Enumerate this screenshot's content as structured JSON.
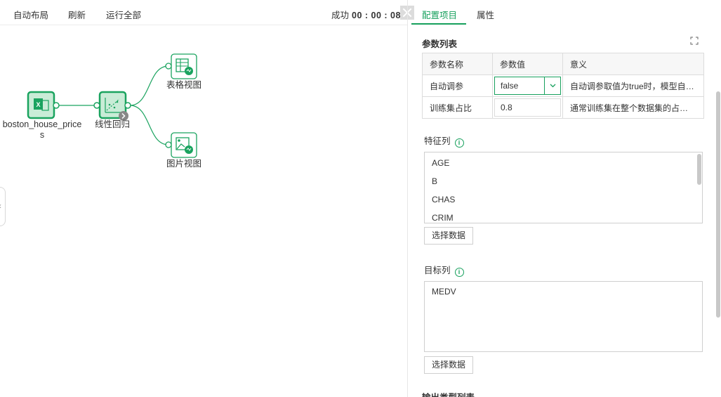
{
  "toolbar": {
    "auto_layout": "自动布局",
    "refresh": "刷新",
    "run_all": "运行全部",
    "status_label": "成功",
    "status_time": "00 : 00 : 08"
  },
  "canvas": {
    "nodes": {
      "source": "boston_house_price\ns",
      "regression": "线性回归",
      "table_view": "表格视图",
      "image_view": "图片视图"
    }
  },
  "panel": {
    "tabs": [
      "配置项目",
      "属性"
    ],
    "params_title": "参数列表",
    "params_table": {
      "headers": [
        "参数名称",
        "参数值",
        "意义"
      ],
      "rows": [
        {
          "name": "自动调参",
          "value": "false",
          "meaning": "自动调参取值为true时，模型自动..."
        },
        {
          "name": "训练集占比",
          "value": "0.8",
          "meaning": "通常训练集在整个数据集的占比为..."
        }
      ]
    },
    "feature_title": "特征列",
    "feature_items": [
      "AGE",
      "B",
      "CHAS",
      "CRIM"
    ],
    "feature_button": "选择数据",
    "target_title": "目标列",
    "target_items": [
      "MEDV"
    ],
    "target_button": "选择数据",
    "output_title": "输出类型列表"
  },
  "colors": {
    "accent": "#17a05d",
    "node_fill": "#c9ecd7",
    "node_stroke": "#1aa35f"
  }
}
